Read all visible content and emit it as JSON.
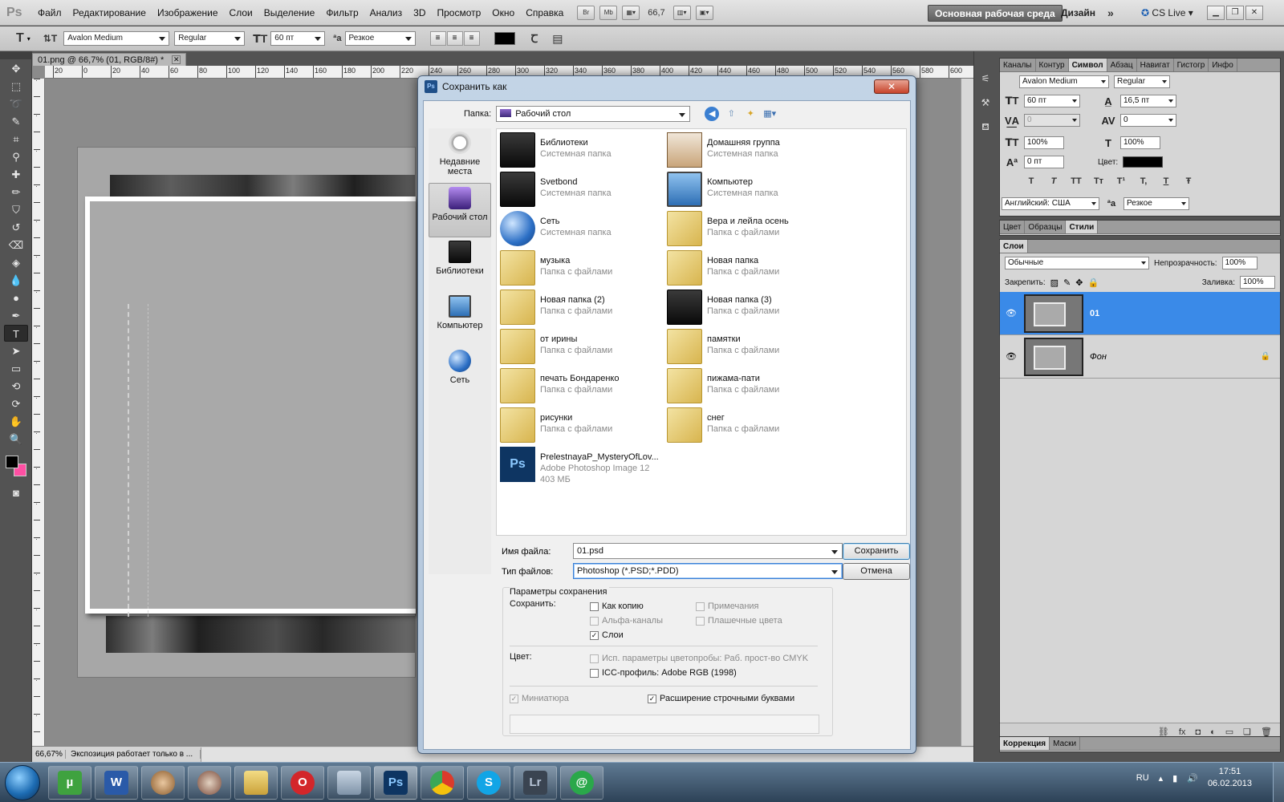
{
  "app": {
    "logo": "Ps",
    "menu": [
      "Файл",
      "Редактирование",
      "Изображение",
      "Слои",
      "Выделение",
      "Фильтр",
      "Анализ",
      "3D",
      "Просмотр",
      "Окно",
      "Справка"
    ],
    "bridge_label": "Br",
    "minibridge_label": "Mb",
    "zoom_display": "66,7",
    "workspace_main": "Основная рабочая среда",
    "workspace_design": "Дизайн",
    "cs_live": "CS Live"
  },
  "options_bar": {
    "font_family": "Avalon Medium",
    "font_style": "Regular",
    "font_size": "60 пт",
    "antialias": "Резкое",
    "text_color": "#000000"
  },
  "document": {
    "tab_title": "01.png @ 66,7% (01, RGB/8#) *",
    "ruler_ticks": [
      "20",
      "0",
      "20",
      "40",
      "60",
      "80",
      "100",
      "120",
      "140",
      "160",
      "180",
      "200",
      "220",
      "240",
      "260",
      "280",
      "300",
      "320",
      "340",
      "360",
      "380",
      "400",
      "420",
      "440",
      "460",
      "480",
      "500",
      "520",
      "540",
      "560",
      "580",
      "600"
    ],
    "status_zoom": "66,67%",
    "status_info": "Экспозиция работает только в ..."
  },
  "colors": {
    "foreground": "#000000",
    "background": "#ff4fa3",
    "selection": "#3a8ae8"
  },
  "character_panel": {
    "tabs": [
      "Каналы",
      "Контур",
      "Символ",
      "Абзац",
      "Навигат",
      "Гистогр",
      "Инфо"
    ],
    "active_tab": "Символ",
    "font_family": "Avalon Medium",
    "font_style": "Regular",
    "size": "60 пт",
    "leading": "16,5 пт",
    "kerning": "0",
    "tracking": "0",
    "vscale": "100%",
    "hscale": "100%",
    "baseline": "0 пт",
    "color_label": "Цвет:",
    "style_buttons": [
      "T",
      "T",
      "TT",
      "Tт",
      "T¹",
      "T,",
      "T",
      "Ŧ"
    ],
    "language": "Английский: США",
    "antialias": "Резкое"
  },
  "styles_panel": {
    "tabs": [
      "Цвет",
      "Образцы",
      "Стили"
    ],
    "active_tab": "Стили"
  },
  "layers_panel": {
    "tab": "Слои",
    "blend_mode": "Обычные",
    "opacity_label": "Непрозрачность:",
    "opacity": "100%",
    "lock_label": "Закрепить:",
    "fill_label": "Заливка:",
    "fill": "100%",
    "layers": [
      {
        "name": "01",
        "selected": true
      },
      {
        "name": "Фон",
        "selected": false,
        "locked": true
      }
    ]
  },
  "adjust_panel": {
    "tabs": [
      "Коррекция",
      "Маски"
    ]
  },
  "dialog": {
    "title": "Сохранить как",
    "close": "✕",
    "folder_label": "Папка:",
    "folder_value": "Рабочий стол",
    "places": [
      {
        "label": "Недавние места"
      },
      {
        "label": "Рабочий стол"
      },
      {
        "label": "Библиотеки"
      },
      {
        "label": "Компьютер"
      },
      {
        "label": "Сеть"
      }
    ],
    "files": [
      {
        "name": "Библиотеки",
        "type": "Системная папка",
        "icon": "dark"
      },
      {
        "name": "Домашняя группа",
        "type": "Системная папка",
        "icon": "home"
      },
      {
        "name": "Svetbond",
        "type": "Системная папка",
        "icon": "dark"
      },
      {
        "name": "Компьютер",
        "type": "Системная папка",
        "icon": "pc"
      },
      {
        "name": "Сеть",
        "type": "Системная папка",
        "icon": "net"
      },
      {
        "name": "Вера и лейла осень",
        "type": "Папка с файлами",
        "icon": "folder"
      },
      {
        "name": "музыка",
        "type": "Папка с файлами",
        "icon": "folder"
      },
      {
        "name": "Новая папка",
        "type": "Папка с файлами",
        "icon": "folder"
      },
      {
        "name": "Новая папка (2)",
        "type": "Папка с файлами",
        "icon": "folder"
      },
      {
        "name": "Новая папка (3)",
        "type": "Папка с файлами",
        "icon": "dark"
      },
      {
        "name": "от ирины",
        "type": "Папка с файлами",
        "icon": "folder"
      },
      {
        "name": "памятки",
        "type": "Папка с файлами",
        "icon": "folder"
      },
      {
        "name": "печать Бондаренко",
        "type": "Папка с файлами",
        "icon": "folder"
      },
      {
        "name": "пижама-пати",
        "type": "Папка с файлами",
        "icon": "folder"
      },
      {
        "name": "рисунки",
        "type": "Папка с файлами",
        "icon": "folder"
      },
      {
        "name": "снег",
        "type": "Папка с файлами",
        "icon": "folder"
      },
      {
        "name": "PrelestnayaP_MysteryOfLov...",
        "type": "Adobe Photoshop Image 12",
        "size": "403 МБ",
        "icon": "psd"
      }
    ],
    "filename_label": "Имя файла:",
    "filename_value": "01.psd",
    "filetype_label": "Тип файлов:",
    "filetype_value": "Photoshop (*.PSD;*.PDD)",
    "save_btn": "Сохранить",
    "cancel_btn": "Отмена",
    "params_title": "Параметры сохранения",
    "save_label": "Сохранить:",
    "opt_copy": "Как копию",
    "opt_notes": "Примечания",
    "opt_alpha": "Альфа-каналы",
    "opt_spot": "Плашечные цвета",
    "opt_layers": "Слои",
    "color_label": "Цвет:",
    "opt_proof": "Исп. параметры цветопробы:  Раб. прост-во CMYK",
    "opt_icc": "ICC-профиль:  Adobe RGB (1998)",
    "opt_thumb": "Миниатюра",
    "opt_lower": "Расширение строчными буквами"
  },
  "taskbar": {
    "apps": [
      "µ",
      "W",
      "",
      "",
      "",
      "O",
      "",
      "Ps",
      "",
      "S",
      "Lr",
      "@"
    ],
    "lang": "RU",
    "time": "17:51",
    "date": "06.02.2013"
  }
}
